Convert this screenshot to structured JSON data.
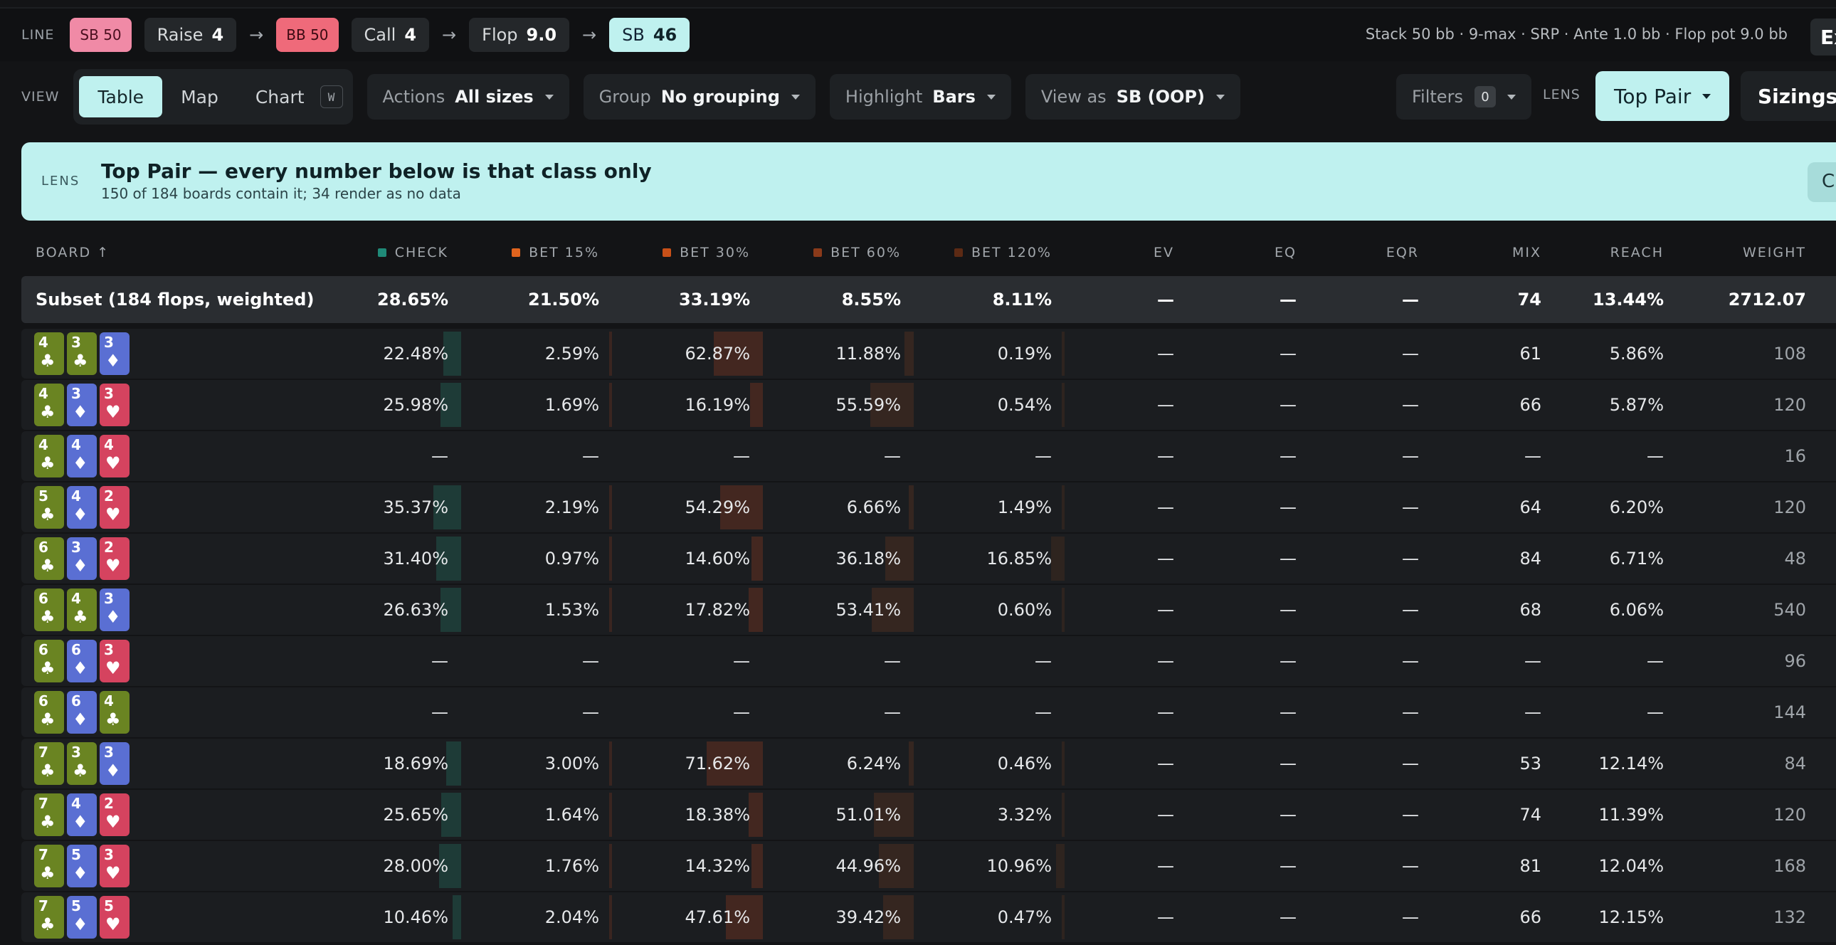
{
  "line": {
    "label": "LINE",
    "chips": [
      {
        "label": "SB 50",
        "style": "pink"
      },
      {
        "label": "Raise",
        "value": "4"
      },
      {
        "label": "BB 50",
        "style": "red"
      },
      {
        "label": "Call",
        "value": "4"
      },
      {
        "label": "Flop",
        "value": "9.0"
      },
      {
        "label": "SB",
        "value": "46",
        "style": "cyan"
      }
    ],
    "arrow": "→",
    "summary": "Stack 50 bb · 9-max · SRP · Ante 1.0 bb · Flop pot 9.0 bb",
    "export_label": "Ex"
  },
  "view": {
    "label": "VIEW",
    "options": [
      "Table",
      "Map",
      "Chart"
    ],
    "active": "Table",
    "shortcut": "W",
    "dropdowns": [
      {
        "label": "Actions",
        "value": "All sizes"
      },
      {
        "label": "Group",
        "value": "No grouping"
      },
      {
        "label": "Highlight",
        "value": "Bars"
      },
      {
        "label": "View as",
        "value": "SB (OOP)"
      }
    ],
    "filters_label": "Filters",
    "filters_count": "0",
    "lens_label": "LENS",
    "lens_value": "Top Pair",
    "sizings_label": "Sizings"
  },
  "banner": {
    "label": "LENS",
    "title": "Top Pair — every number below is that class only",
    "subtitle": "150 of 184 boards contain it; 34 render as no data",
    "close_label": "C"
  },
  "colors": {
    "check": "#1f8a78",
    "bet15": "#e0641e",
    "bet30": "#c85018",
    "bet60": "#8a3a1a",
    "bet120": "#5c2a14",
    "club": "#6a8422",
    "diamond": "#5a6fd3",
    "heart": "#d5435f"
  },
  "table": {
    "columns": [
      "BOARD ↑",
      "CHECK",
      "BET 15%",
      "BET 30%",
      "BET 60%",
      "BET 120%",
      "EV",
      "EQ",
      "EQR",
      "MIX",
      "REACH",
      "WEIGHT"
    ],
    "subset": {
      "label": "Subset (184 flops, weighted)",
      "check": "28.65%",
      "bet15": "21.50%",
      "bet30": "33.19%",
      "bet60": "8.55%",
      "bet120": "8.11%",
      "ev": "—",
      "eq": "—",
      "eqr": "—",
      "mix": "74",
      "reach": "13.44%",
      "weight": "2712.07"
    },
    "rows": [
      {
        "cards": [
          [
            "4",
            "♣",
            "c"
          ],
          [
            "3",
            "♣",
            "c"
          ],
          [
            "3",
            "♦",
            "d"
          ]
        ],
        "check": "22.48%",
        "bet15": "2.59%",
        "bet30": "62.87%",
        "bet60": "11.88%",
        "bet120": "0.19%",
        "ev": "—",
        "eq": "—",
        "eqr": "—",
        "mix": "61",
        "reach": "5.86%",
        "weight": "108"
      },
      {
        "cards": [
          [
            "4",
            "♣",
            "c"
          ],
          [
            "3",
            "♦",
            "d"
          ],
          [
            "3",
            "♥",
            "h"
          ]
        ],
        "check": "25.98%",
        "bet15": "1.69%",
        "bet30": "16.19%",
        "bet60": "55.59%",
        "bet120": "0.54%",
        "ev": "—",
        "eq": "—",
        "eqr": "—",
        "mix": "66",
        "reach": "5.87%",
        "weight": "120"
      },
      {
        "cards": [
          [
            "4",
            "♣",
            "c"
          ],
          [
            "4",
            "♦",
            "d"
          ],
          [
            "4",
            "♥",
            "h"
          ]
        ],
        "check": "—",
        "bet15": "—",
        "bet30": "—",
        "bet60": "—",
        "bet120": "—",
        "ev": "—",
        "eq": "—",
        "eqr": "—",
        "mix": "—",
        "reach": "—",
        "weight": "16"
      },
      {
        "cards": [
          [
            "5",
            "♣",
            "c"
          ],
          [
            "4",
            "♦",
            "d"
          ],
          [
            "2",
            "♥",
            "h"
          ]
        ],
        "check": "35.37%",
        "bet15": "2.19%",
        "bet30": "54.29%",
        "bet60": "6.66%",
        "bet120": "1.49%",
        "ev": "—",
        "eq": "—",
        "eqr": "—",
        "mix": "64",
        "reach": "6.20%",
        "weight": "120"
      },
      {
        "cards": [
          [
            "6",
            "♣",
            "c"
          ],
          [
            "3",
            "♦",
            "d"
          ],
          [
            "2",
            "♥",
            "h"
          ]
        ],
        "check": "31.40%",
        "bet15": "0.97%",
        "bet30": "14.60%",
        "bet60": "36.18%",
        "bet120": "16.85%",
        "ev": "—",
        "eq": "—",
        "eqr": "—",
        "mix": "84",
        "reach": "6.71%",
        "weight": "48"
      },
      {
        "cards": [
          [
            "6",
            "♣",
            "c"
          ],
          [
            "4",
            "♣",
            "c"
          ],
          [
            "3",
            "♦",
            "d"
          ]
        ],
        "check": "26.63%",
        "bet15": "1.53%",
        "bet30": "17.82%",
        "bet60": "53.41%",
        "bet120": "0.60%",
        "ev": "—",
        "eq": "—",
        "eqr": "—",
        "mix": "68",
        "reach": "6.06%",
        "weight": "540"
      },
      {
        "cards": [
          [
            "6",
            "♣",
            "c"
          ],
          [
            "6",
            "♦",
            "d"
          ],
          [
            "3",
            "♥",
            "h"
          ]
        ],
        "check": "—",
        "bet15": "—",
        "bet30": "—",
        "bet60": "—",
        "bet120": "—",
        "ev": "—",
        "eq": "—",
        "eqr": "—",
        "mix": "—",
        "reach": "—",
        "weight": "96"
      },
      {
        "cards": [
          [
            "6",
            "♣",
            "c"
          ],
          [
            "6",
            "♦",
            "d"
          ],
          [
            "4",
            "♣",
            "c"
          ]
        ],
        "check": "—",
        "bet15": "—",
        "bet30": "—",
        "bet60": "—",
        "bet120": "—",
        "ev": "—",
        "eq": "—",
        "eqr": "—",
        "mix": "—",
        "reach": "—",
        "weight": "144"
      },
      {
        "cards": [
          [
            "7",
            "♣",
            "c"
          ],
          [
            "3",
            "♣",
            "c"
          ],
          [
            "3",
            "♦",
            "d"
          ]
        ],
        "check": "18.69%",
        "bet15": "3.00%",
        "bet30": "71.62%",
        "bet60": "6.24%",
        "bet120": "0.46%",
        "ev": "—",
        "eq": "—",
        "eqr": "—",
        "mix": "53",
        "reach": "12.14%",
        "weight": "84"
      },
      {
        "cards": [
          [
            "7",
            "♣",
            "c"
          ],
          [
            "4",
            "♦",
            "d"
          ],
          [
            "2",
            "♥",
            "h"
          ]
        ],
        "check": "25.65%",
        "bet15": "1.64%",
        "bet30": "18.38%",
        "bet60": "51.01%",
        "bet120": "3.32%",
        "ev": "—",
        "eq": "—",
        "eqr": "—",
        "mix": "74",
        "reach": "11.39%",
        "weight": "120"
      },
      {
        "cards": [
          [
            "7",
            "♣",
            "c"
          ],
          [
            "5",
            "♦",
            "d"
          ],
          [
            "3",
            "♥",
            "h"
          ]
        ],
        "check": "28.00%",
        "bet15": "1.76%",
        "bet30": "14.32%",
        "bet60": "44.96%",
        "bet120": "10.96%",
        "ev": "—",
        "eq": "—",
        "eqr": "—",
        "mix": "81",
        "reach": "12.04%",
        "weight": "168"
      },
      {
        "cards": [
          [
            "7",
            "♣",
            "c"
          ],
          [
            "5",
            "♦",
            "d"
          ],
          [
            "5",
            "♥",
            "h"
          ]
        ],
        "check": "10.46%",
        "bet15": "2.04%",
        "bet30": "47.61%",
        "bet60": "39.42%",
        "bet120": "0.47%",
        "ev": "—",
        "eq": "—",
        "eqr": "—",
        "mix": "66",
        "reach": "12.15%",
        "weight": "132"
      }
    ]
  }
}
